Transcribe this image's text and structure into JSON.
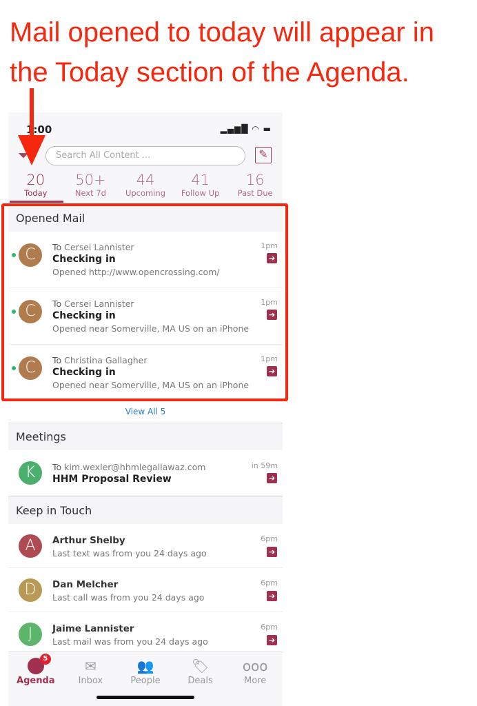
{
  "annotation": {
    "line1": "Mail opened to today will appear in",
    "line2": "the Today section of the Agenda."
  },
  "status": {
    "time": "1:00",
    "icons": "signal wifi battery"
  },
  "search": {
    "placeholder": "Search All Content ..."
  },
  "tabs": [
    {
      "count": "20",
      "label": "Today"
    },
    {
      "count": "50+",
      "label": "Next 7d"
    },
    {
      "count": "44",
      "label": "Upcoming"
    },
    {
      "count": "41",
      "label": "Follow Up"
    },
    {
      "count": "16",
      "label": "Past Due"
    }
  ],
  "opened_mail": {
    "title": "Opened Mail",
    "view_all": "View All 5",
    "items": [
      {
        "initial": "C",
        "prefix": "To",
        "to": "Cersei Lannister",
        "subject": "Checking in",
        "detail": "Opened http://www.opencrossing.com/",
        "time": "1pm",
        "color": "#b07c4e"
      },
      {
        "initial": "C",
        "prefix": "To",
        "to": "Cersei Lannister",
        "subject": "Checking in",
        "detail": "Opened near Somerville, MA US on an iPhone",
        "time": "1pm",
        "color": "#b07c4e"
      },
      {
        "initial": "C",
        "prefix": "To",
        "to": "Christina Gallagher",
        "subject": "Checking in",
        "detail": "Opened near Somerville, MA US on an iPhone",
        "time": "1pm",
        "color": "#b07c4e"
      }
    ]
  },
  "meetings": {
    "title": "Meetings",
    "items": [
      {
        "initial": "K",
        "prefix": "To",
        "to": "kim.wexler@hhmlegallawaz.com",
        "subject": "HHM Proposal Review",
        "time": "in 59m",
        "color": "#4caf6e"
      }
    ]
  },
  "keep_in_touch": {
    "title": "Keep in Touch",
    "items": [
      {
        "initial": "A",
        "name": "Arthur Shelby",
        "detail": "Last text was from you 24 days ago",
        "time": "6pm",
        "color": "#b04a52"
      },
      {
        "initial": "D",
        "name": "Dan Melcher",
        "detail": "Last call was from you 24 days ago",
        "time": "6pm",
        "color": "#b89a55"
      },
      {
        "initial": "J",
        "name": "Jaime Lannister",
        "detail": "Last mail was from you 24 days ago",
        "time": "6pm",
        "color": "#5bb56a"
      }
    ]
  },
  "tabbar": {
    "badge": "5",
    "items": [
      {
        "label": "Agenda"
      },
      {
        "label": "Inbox"
      },
      {
        "label": "People"
      },
      {
        "label": "Deals"
      },
      {
        "label": "More"
      }
    ]
  },
  "colors": {
    "accent": "#a0304f",
    "annotation": "#f5280f",
    "link": "#2a7fc4"
  }
}
